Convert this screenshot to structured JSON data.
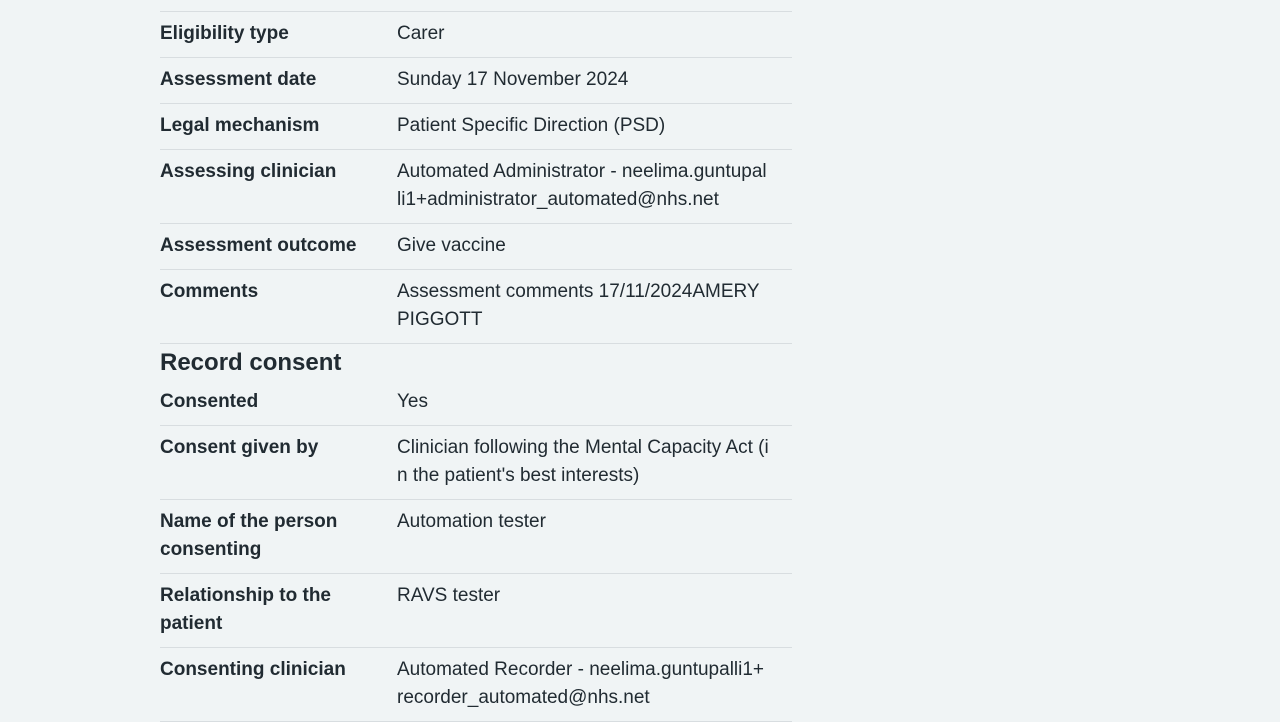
{
  "assessment": {
    "rows": [
      {
        "key": "Eligibility type",
        "value": "Carer"
      },
      {
        "key": "Assessment date",
        "value": "Sunday 17 November 2024"
      },
      {
        "key": "Legal mechanism",
        "value": "Patient Specific Direction (PSD)"
      },
      {
        "key": "Assessing clinician",
        "value": "Automated Administrator - neelima.guntupalli1+administrator_automated@nhs.net"
      },
      {
        "key": "Assessment outcome",
        "value": "Give vaccine"
      },
      {
        "key": "Comments",
        "value": "Assessment comments 17/11/2024AMERY PIGGOTT"
      }
    ]
  },
  "consent": {
    "heading": "Record consent",
    "rows": [
      {
        "key": "Consented",
        "value": "Yes"
      },
      {
        "key": "Consent given by",
        "value": "Clinician following the Mental Capacity Act (in the patient's best interests)"
      },
      {
        "key": "Name of the person consenting",
        "value": "Automation tester"
      },
      {
        "key": "Relationship to the patient",
        "value": "RAVS tester"
      },
      {
        "key": "Consenting clinician",
        "value": "Automated Recorder - neelima.guntupalli1+recorder_automated@nhs.net"
      }
    ]
  }
}
